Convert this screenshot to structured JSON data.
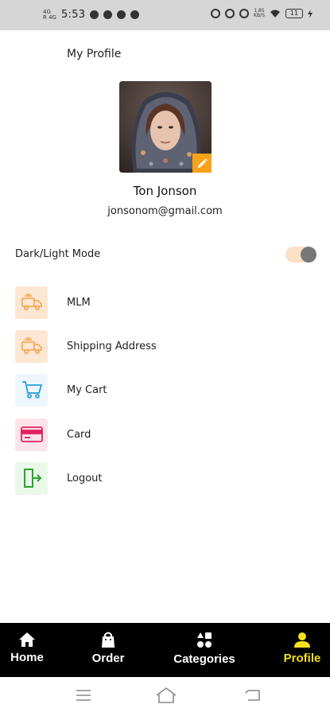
{
  "status_bar": {
    "network_text": "4G\nR 4G",
    "time": "5:53",
    "speed_text": "1.85\nKB/S",
    "battery": "11"
  },
  "page": {
    "title": "My Profile"
  },
  "profile": {
    "name": "Ton Jonson",
    "email": "jonsonom@gmail.com"
  },
  "settings": {
    "mode_label": "Dark/Light Mode",
    "mode_on": true
  },
  "menu": {
    "items": [
      {
        "label": "MLM",
        "icon": "delivery-truck-icon",
        "bg": "#fde7d3",
        "color": "#f5a04a"
      },
      {
        "label": "Shipping Address",
        "icon": "delivery-truck-icon",
        "bg": "#fde7d3",
        "color": "#f5a04a"
      },
      {
        "label": "My Cart",
        "icon": "cart-icon",
        "bg": "#eef7fc",
        "color": "#2a9fd6"
      },
      {
        "label": "Card",
        "icon": "credit-card-icon",
        "bg": "#fde3ea",
        "color": "#e0245e"
      },
      {
        "label": "Logout",
        "icon": "logout-icon",
        "bg": "#eaf8ea",
        "color": "#2aa52a"
      }
    ]
  },
  "bottom_nav": {
    "items": [
      {
        "label": "Home",
        "icon": "home-icon"
      },
      {
        "label": "Order",
        "icon": "shopping-bag-icon"
      },
      {
        "label": "Categories",
        "icon": "categories-icon"
      },
      {
        "label": "Profile",
        "icon": "person-icon",
        "active": true
      }
    ],
    "active_color": "#f4e11c"
  },
  "colors": {
    "accent": "#f7a21b",
    "nav_bg": "#000000"
  }
}
